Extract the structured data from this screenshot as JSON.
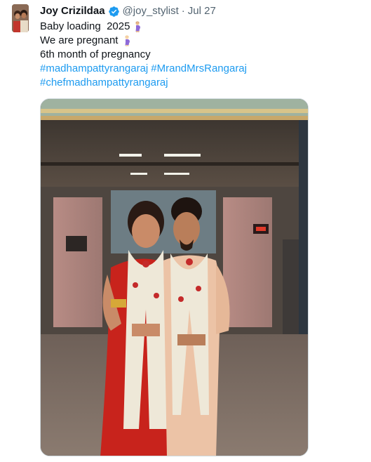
{
  "tweet": {
    "display_name": "Joy Crizildaa",
    "handle": "@joy_stylist",
    "separator": "·",
    "timestamp": "Jul 27",
    "lines": [
      "Baby loading  2025",
      "We are pregnant",
      "6th month of pregnancy"
    ],
    "hashtags": [
      "#madhampattyrangaraj",
      "#MrandMrsRangaraj",
      "#chefmadhampattyrangaraj"
    ],
    "icons": {
      "verified": "verified-badge-icon",
      "pregnant_emoji": "pregnant-woman-emoji",
      "pregnant_emoji_2": "pregnant-woman-light-emoji"
    },
    "colors": {
      "link": "#1d9bf0",
      "verified": "#1d9bf0",
      "secondary_text": "#536471"
    }
  }
}
